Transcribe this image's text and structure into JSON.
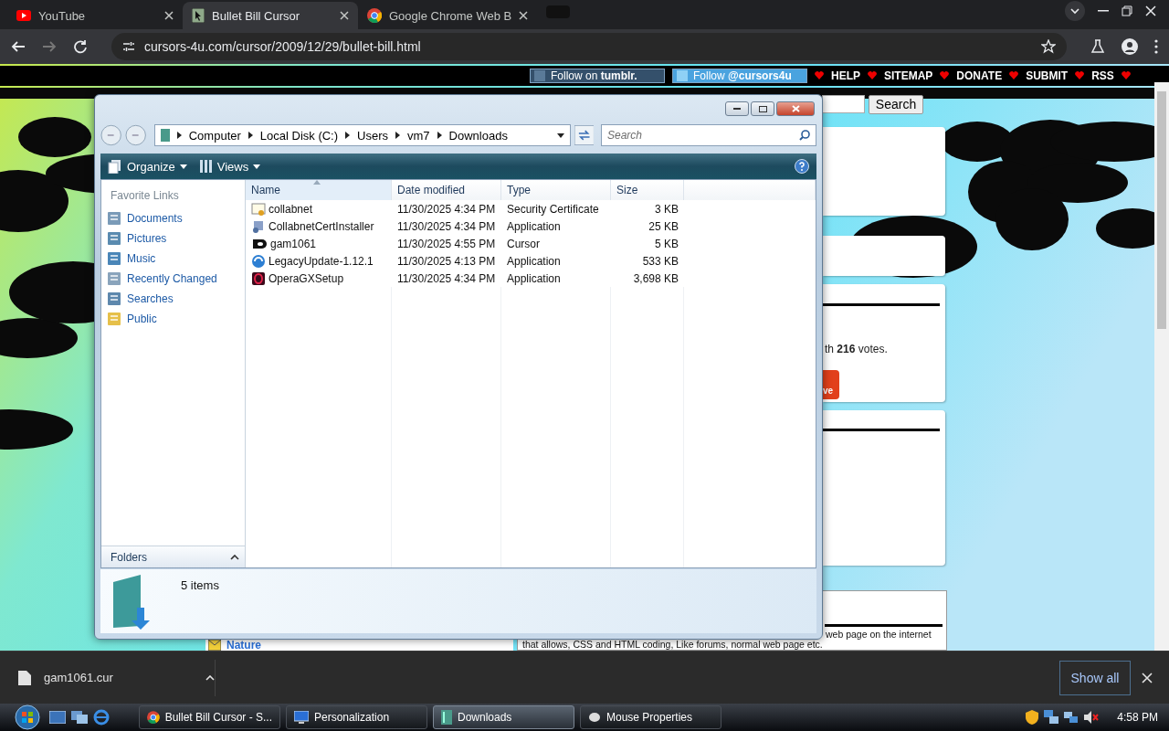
{
  "browser": {
    "tabs": [
      {
        "title": "YouTube",
        "kind": "youtube",
        "selected": false
      },
      {
        "title": "Bullet Bill Cursor",
        "kind": "cursor",
        "selected": true
      },
      {
        "title": "Google Chrome Web B",
        "kind": "chrome",
        "selected": false
      }
    ],
    "url": "cursors-4u.com/cursor/2009/12/29/bullet-bill.html"
  },
  "webpage": {
    "follow_buttons": [
      {
        "kind": "tumblr",
        "label": "Follow on **tumblr.**"
      },
      {
        "kind": "twitter",
        "label": "Follow **@cursors4u**"
      }
    ],
    "nav_links": [
      "HELP",
      "SITEMAP",
      "DONATE",
      "SUBMIT",
      "RSS"
    ],
    "search_button": "Search",
    "vote_text": "th **216** votes.",
    "vote_button": "ve",
    "nature_link": "Nature",
    "description": [
      "web page on the internet",
      "that allows, CSS and HTML coding, Like forums, normal web page etc."
    ]
  },
  "explorer": {
    "breadcrumb": [
      "Computer",
      "Local Disk (C:)",
      "Users",
      "vm7",
      "Downloads"
    ],
    "search_placeholder": "Search",
    "toolbar": [
      {
        "label": "Organize",
        "kind": "organize"
      },
      {
        "label": "Views",
        "kind": "views"
      }
    ],
    "favorites_title": "Favorite Links",
    "favorites": [
      {
        "label": "Documents",
        "kind": "documents"
      },
      {
        "label": "Pictures",
        "kind": "pictures"
      },
      {
        "label": "Music",
        "kind": "music"
      },
      {
        "label": "Recently Changed",
        "kind": "recent"
      },
      {
        "label": "Searches",
        "kind": "searches"
      },
      {
        "label": "Public",
        "kind": "public"
      }
    ],
    "columns": [
      {
        "label": "Name",
        "sorted": true
      },
      {
        "label": "Date modified",
        "sorted": false
      },
      {
        "label": "Type",
        "sorted": false
      },
      {
        "label": "Size",
        "sorted": false
      }
    ],
    "files": [
      {
        "name": "collabnet",
        "date": "11/30/2025 4:34 PM",
        "type": "Security Certificate",
        "size": "3 KB",
        "kind": "certificate"
      },
      {
        "name": "CollabnetCertInstaller",
        "date": "11/30/2025 4:34 PM",
        "type": "Application",
        "size": "25 KB",
        "kind": "installer"
      },
      {
        "name": "gam1061",
        "date": "11/30/2025 4:55 PM",
        "type": "Cursor",
        "size": "5 KB",
        "kind": "bullet"
      },
      {
        "name": "LegacyUpdate-1.12.1",
        "date": "11/30/2025 4:13 PM",
        "type": "Application",
        "size": "533 KB",
        "kind": "globe"
      },
      {
        "name": "OperaGXSetup",
        "date": "11/30/2025 4:34 PM",
        "type": "Application",
        "size": "3,698 KB",
        "kind": "opera"
      }
    ],
    "folders_label": "Folders",
    "status": "5 items"
  },
  "downloads": {
    "file": "gam1061.cur",
    "show_all": "Show all"
  },
  "taskbar": {
    "tasks": [
      {
        "label": "Bullet Bill Cursor - S...",
        "kind": "chrome",
        "selected": false
      },
      {
        "label": "Personalization",
        "kind": "monitor",
        "selected": false
      },
      {
        "label": "Downloads",
        "kind": "folder",
        "selected": true
      },
      {
        "label": "Mouse Properties",
        "kind": "mouse",
        "selected": false
      }
    ],
    "clock": "4:58 PM"
  }
}
